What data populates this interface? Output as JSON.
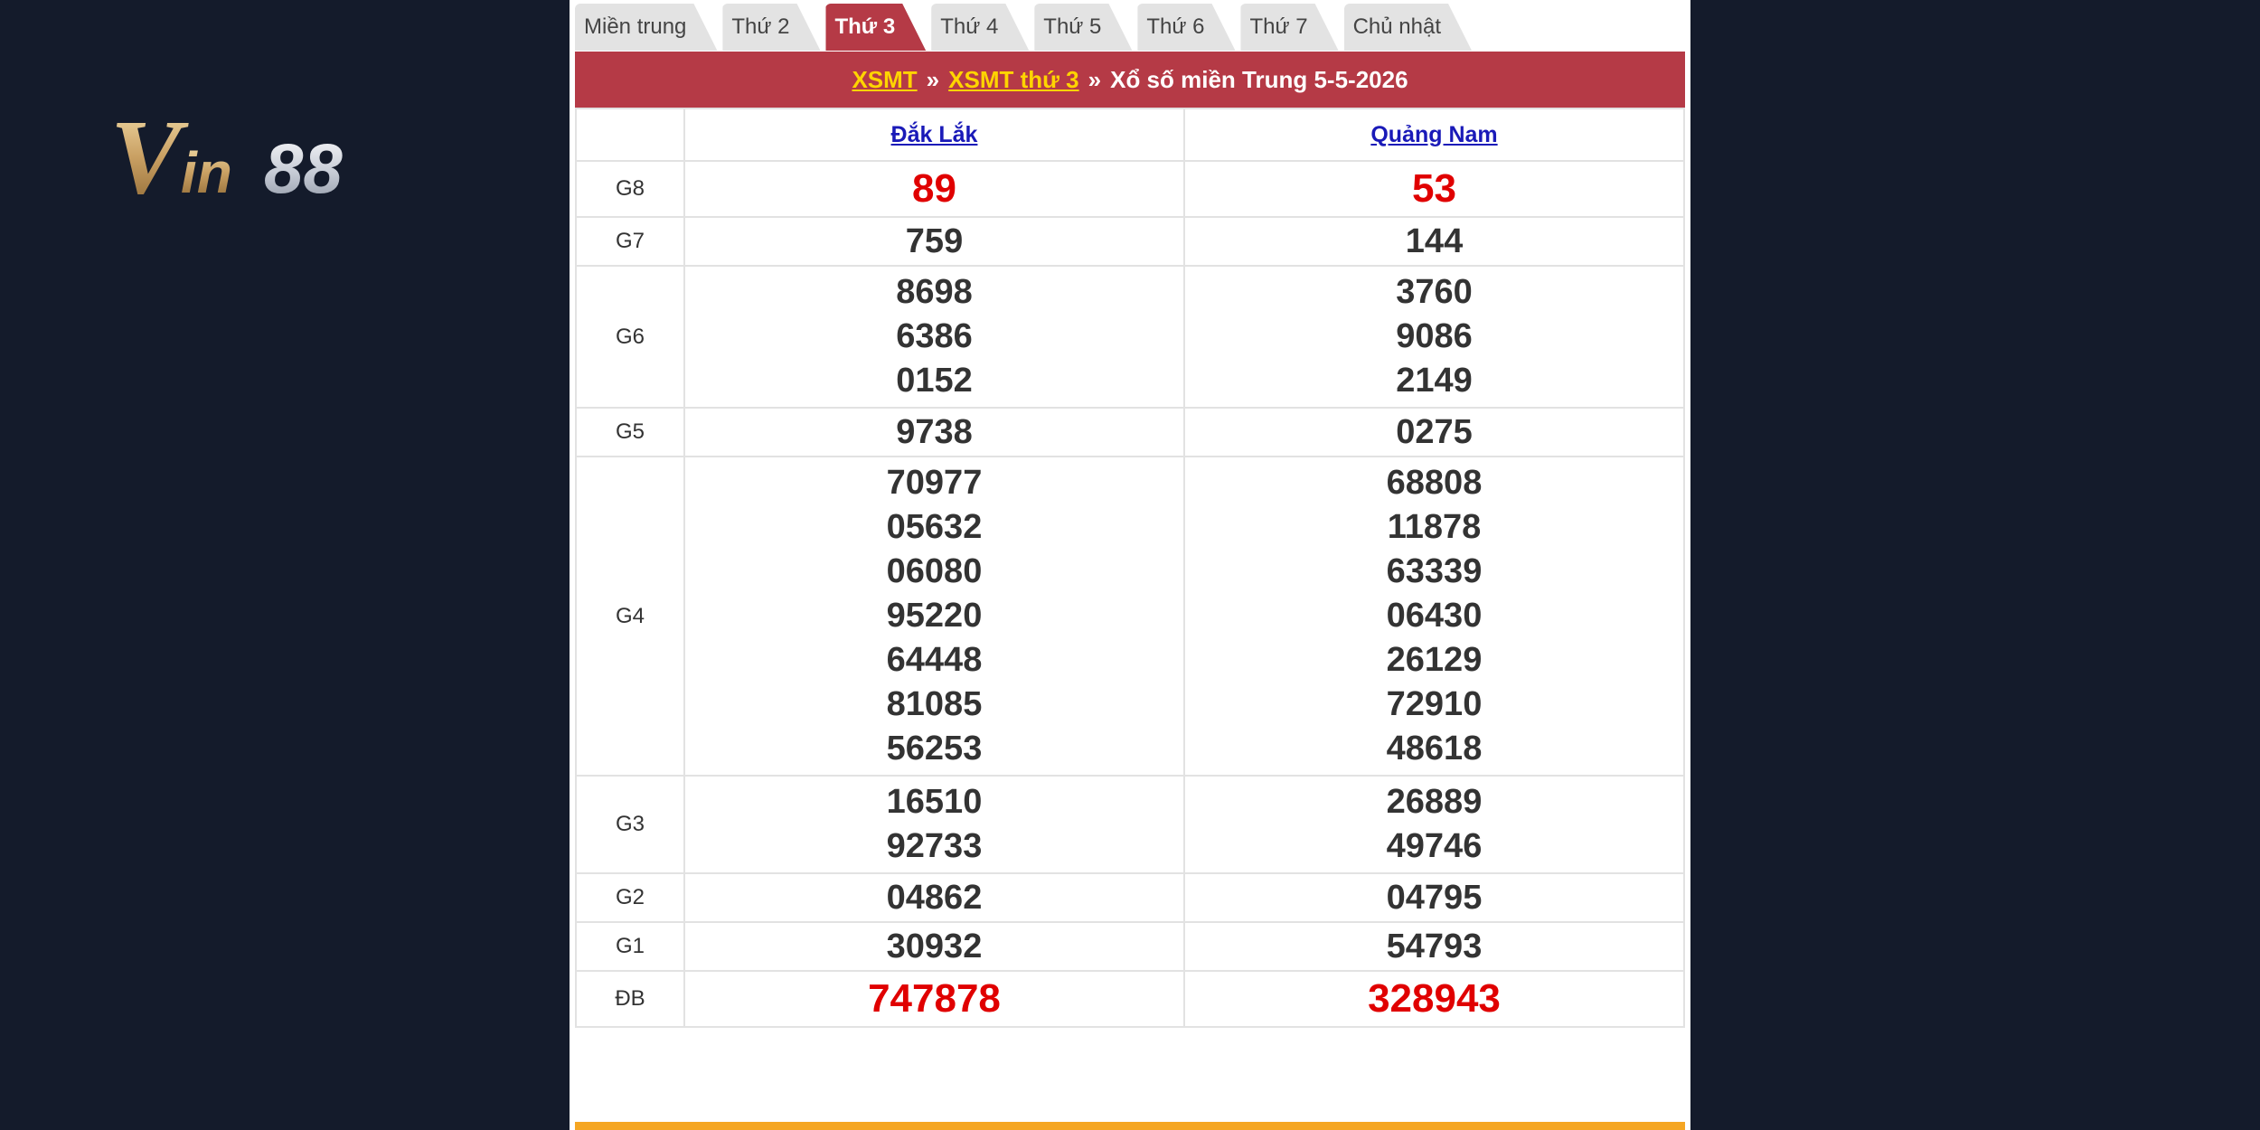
{
  "logo": {
    "text": "Vin88"
  },
  "tabs": [
    {
      "label": "Miền trung",
      "active": false
    },
    {
      "label": "Thứ 2",
      "active": false
    },
    {
      "label": "Thứ 3",
      "active": true
    },
    {
      "label": "Thứ 4",
      "active": false
    },
    {
      "label": "Thứ 5",
      "active": false
    },
    {
      "label": "Thứ 6",
      "active": false
    },
    {
      "label": "Thứ 7",
      "active": false
    },
    {
      "label": "Chủ nhật",
      "active": false
    }
  ],
  "breadcrumb": {
    "link1": "XSMT",
    "sep1": "»",
    "link2": "XSMT thứ 3",
    "sep2": "»",
    "current": "Xổ số miền Trung 5-5-2026"
  },
  "provinces": [
    "Đắk Lắk",
    "Quảng Nam"
  ],
  "prizes": [
    {
      "name": "G8",
      "highlight": true,
      "values": [
        [
          "89"
        ],
        [
          "53"
        ]
      ]
    },
    {
      "name": "G7",
      "highlight": false,
      "values": [
        [
          "759"
        ],
        [
          "144"
        ]
      ]
    },
    {
      "name": "G6",
      "highlight": false,
      "values": [
        [
          "8698",
          "6386",
          "0152"
        ],
        [
          "3760",
          "9086",
          "2149"
        ]
      ]
    },
    {
      "name": "G5",
      "highlight": false,
      "values": [
        [
          "9738"
        ],
        [
          "0275"
        ]
      ]
    },
    {
      "name": "G4",
      "highlight": false,
      "values": [
        [
          "70977",
          "05632",
          "06080",
          "95220",
          "64448",
          "81085",
          "56253"
        ],
        [
          "68808",
          "11878",
          "63339",
          "06430",
          "26129",
          "72910",
          "48618"
        ]
      ]
    },
    {
      "name": "G3",
      "highlight": false,
      "values": [
        [
          "16510",
          "92733"
        ],
        [
          "26889",
          "49746"
        ]
      ]
    },
    {
      "name": "G2",
      "highlight": false,
      "values": [
        [
          "04862"
        ],
        [
          "04795"
        ]
      ]
    },
    {
      "name": "G1",
      "highlight": false,
      "values": [
        [
          "30932"
        ],
        [
          "54793"
        ]
      ]
    },
    {
      "name": "ĐB",
      "highlight": true,
      "values": [
        [
          "747878"
        ],
        [
          "328943"
        ]
      ]
    }
  ],
  "colors": {
    "background": "#141b2b",
    "accent_red": "#b53a46",
    "link_yellow": "#ffd400",
    "prize_red": "#e00000",
    "bottom_bar": "#f5a623"
  }
}
